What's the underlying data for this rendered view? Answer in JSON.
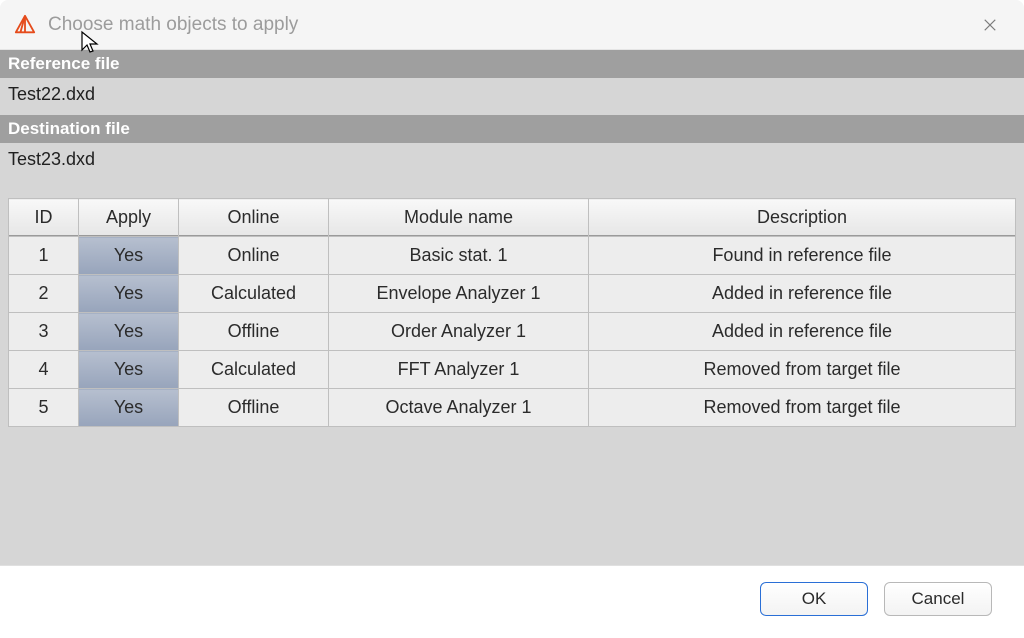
{
  "window": {
    "title": "Choose math objects to apply"
  },
  "sections": {
    "reference_label": "Reference file",
    "reference_value": "Test22.dxd",
    "destination_label": "Destination file",
    "destination_value": "Test23.dxd"
  },
  "table": {
    "headers": {
      "id": "ID",
      "apply": "Apply",
      "online": "Online",
      "module": "Module name",
      "description": "Description"
    },
    "rows": [
      {
        "id": "1",
        "apply": "Yes",
        "online": "Online",
        "module": "Basic stat. 1",
        "description": "Found in reference file"
      },
      {
        "id": "2",
        "apply": "Yes",
        "online": "Calculated",
        "module": "Envelope Analyzer 1",
        "description": "Added in reference file"
      },
      {
        "id": "3",
        "apply": "Yes",
        "online": "Offline",
        "module": "Order Analyzer 1",
        "description": "Added in reference file"
      },
      {
        "id": "4",
        "apply": "Yes",
        "online": "Calculated",
        "module": "FFT Analyzer 1",
        "description": "Removed from target file"
      },
      {
        "id": "5",
        "apply": "Yes",
        "online": "Offline",
        "module": "Octave Analyzer 1",
        "description": "Removed from target file"
      }
    ]
  },
  "buttons": {
    "ok": "OK",
    "cancel": "Cancel"
  }
}
